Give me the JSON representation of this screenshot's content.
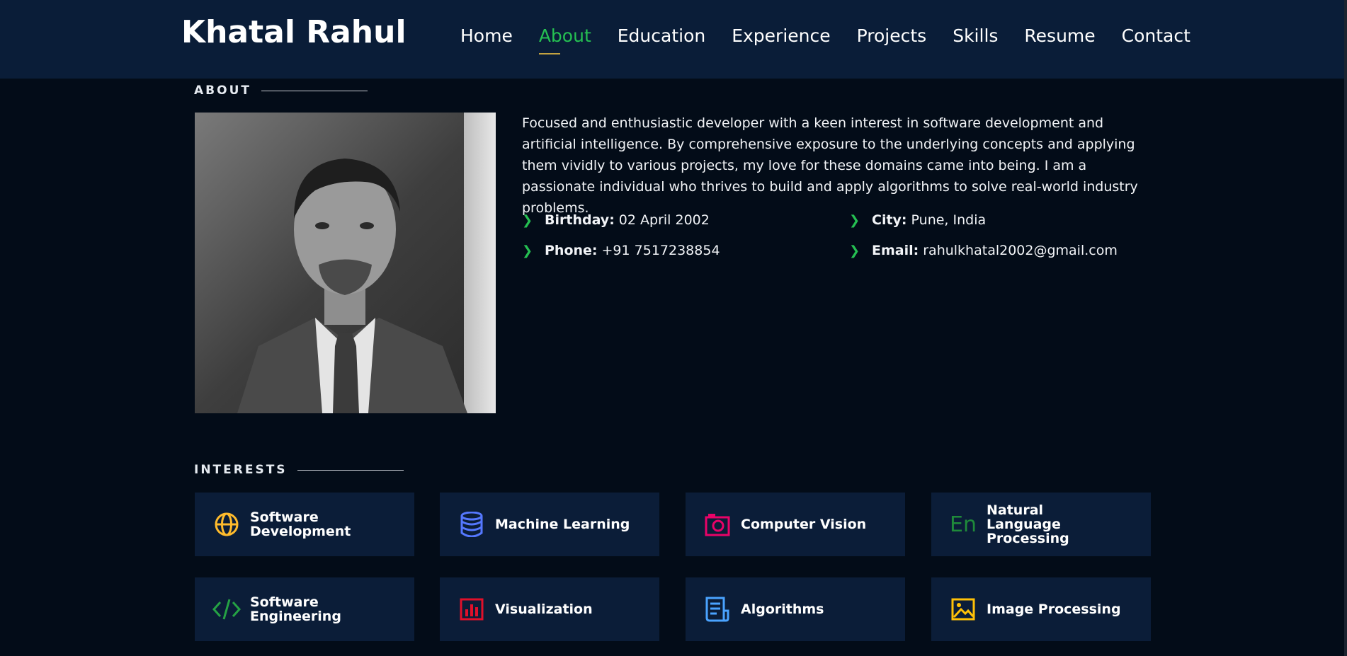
{
  "header": {
    "logo": "Khatal Rahul",
    "nav": [
      "Home",
      "About",
      "Education",
      "Experience",
      "Projects",
      "Skills",
      "Resume",
      "Contact"
    ],
    "active_nav": "About",
    "accent_color": "#25c052"
  },
  "about": {
    "title": "ABOUT",
    "description": "Focused and enthusiastic developer with a keen interest in software development and artificial intelligence. By comprehensive exposure to the underlying concepts and applying them vividly to various projects, my love for these domains came into being. I am a passionate individual who thrives to build and apply algorithms to solve real-world industry problems.",
    "info": {
      "birthday": {
        "label": "Birthday:",
        "value": "02 April 2002"
      },
      "city": {
        "label": "City:",
        "value": "Pune, India"
      },
      "phone": {
        "label": "Phone:",
        "value": "+91 7517238854"
      },
      "email": {
        "label": "Email:",
        "value": "rahulkhatal2002@gmail.com"
      }
    }
  },
  "interests": {
    "title": "INTERESTS",
    "items": [
      {
        "label": "Software Development",
        "icon": "globe-icon",
        "color": "#ffbb2c"
      },
      {
        "label": "Machine Learning",
        "icon": "database-icon",
        "color": "#5578ff"
      },
      {
        "label": "Computer Vision",
        "icon": "camera-icon",
        "color": "#e80368"
      },
      {
        "label": "Natural Language Processing",
        "icon": "language-icon",
        "color": "#1f8a3a",
        "glyph": "En"
      },
      {
        "label": "Software Engineering",
        "icon": "code-icon",
        "color": "#25a244"
      },
      {
        "label": "Visualization",
        "icon": "bar-chart-icon",
        "color": "#e0102a"
      },
      {
        "label": "Algorithms",
        "icon": "document-icon",
        "color": "#4aa3ff"
      },
      {
        "label": "Image Processing",
        "icon": "image-icon",
        "color": "#ffc107"
      }
    ]
  }
}
